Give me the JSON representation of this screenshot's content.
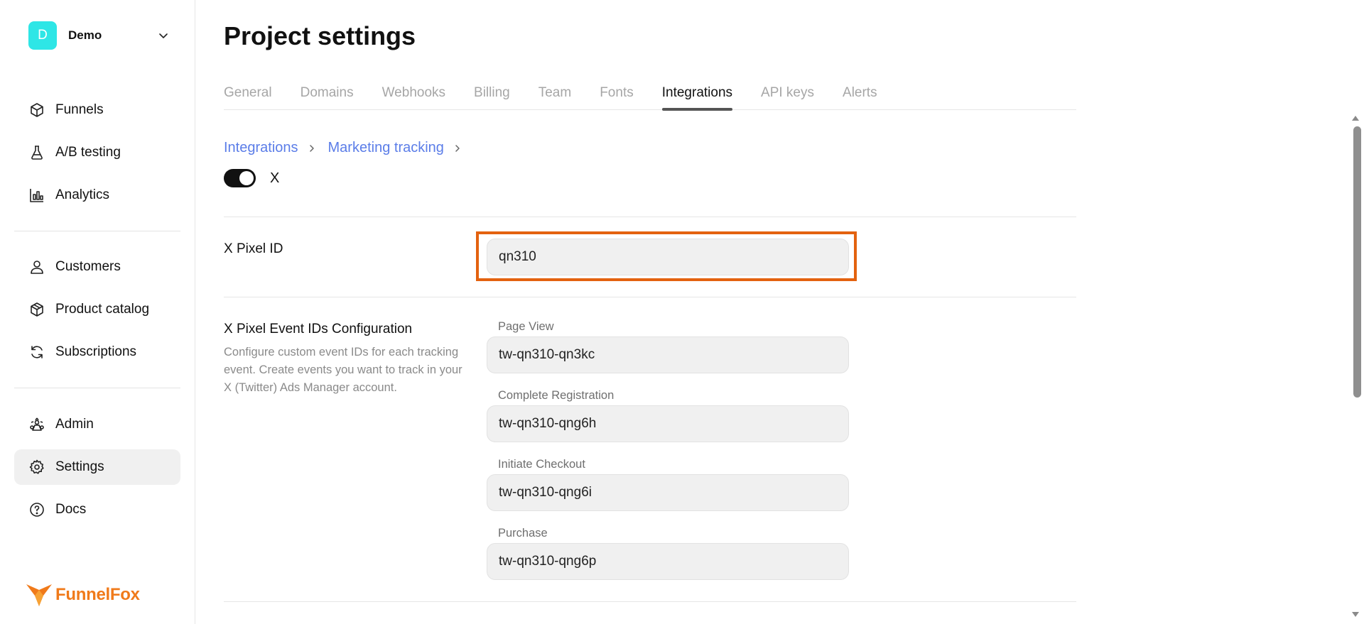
{
  "workspace": {
    "initial": "D",
    "name": "Demo",
    "avatar_color": "#2EE6E6"
  },
  "sidebar": {
    "groups": [
      {
        "items": [
          {
            "label": "Funnels",
            "icon": "cube-icon"
          },
          {
            "label": "A/B testing",
            "icon": "flask-icon"
          },
          {
            "label": "Analytics",
            "icon": "bar-chart-icon"
          }
        ]
      },
      {
        "items": [
          {
            "label": "Customers",
            "icon": "user-icon"
          },
          {
            "label": "Product catalog",
            "icon": "package-icon"
          },
          {
            "label": "Subscriptions",
            "icon": "refresh-icon"
          }
        ]
      },
      {
        "items": [
          {
            "label": "Admin",
            "icon": "admin-icon"
          },
          {
            "label": "Settings",
            "icon": "gear-icon",
            "active": true
          },
          {
            "label": "Docs",
            "icon": "help-circle-icon"
          }
        ]
      }
    ]
  },
  "brand": {
    "name": "FunnelFox",
    "color": "#F07A1A"
  },
  "page": {
    "title": "Project settings",
    "tabs": [
      {
        "label": "General"
      },
      {
        "label": "Domains"
      },
      {
        "label": "Webhooks"
      },
      {
        "label": "Billing"
      },
      {
        "label": "Team"
      },
      {
        "label": "Fonts"
      },
      {
        "label": "Integrations",
        "active": true
      },
      {
        "label": "API keys"
      },
      {
        "label": "Alerts"
      }
    ],
    "breadcrumb": [
      "Integrations",
      "Marketing tracking"
    ],
    "toggle": {
      "label": "X",
      "enabled": true
    }
  },
  "pixel_id": {
    "title": "X Pixel ID",
    "value": "qn310"
  },
  "event_config": {
    "title": "X Pixel Event IDs Configuration",
    "description": "Configure custom event IDs for each tracking event. Create events you want to track in your X (Twitter) Ads Manager account.",
    "events": [
      {
        "label": "Page View",
        "value": "tw-qn310-qn3kc"
      },
      {
        "label": "Complete Registration",
        "value": "tw-qn310-qng6h"
      },
      {
        "label": "Initiate Checkout",
        "value": "tw-qn310-qng6i"
      },
      {
        "label": "Purchase",
        "value": "tw-qn310-qng6p"
      }
    ]
  },
  "colors": {
    "link": "#5B7DE8",
    "highlight": "#E3620F"
  }
}
